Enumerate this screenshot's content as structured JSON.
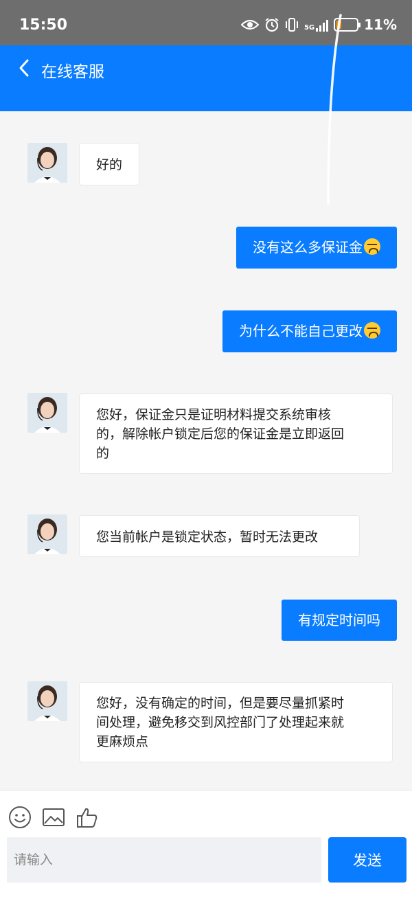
{
  "status_bar": {
    "time": "15:50",
    "network": "5G",
    "battery_percent": "11%",
    "battery_level": 0.11,
    "icons": [
      "eye-icon",
      "alarm-icon",
      "vibrate-icon",
      "signal-icon",
      "battery-icon"
    ]
  },
  "header": {
    "title": "在线客服",
    "back_icon": "chevron-left-icon",
    "color": "#0a7cff"
  },
  "messages": [
    {
      "side": "agent",
      "text": "好的"
    },
    {
      "side": "user",
      "text": "没有这么多保证金",
      "emoji": "tired-face-emoji"
    },
    {
      "side": "user",
      "text": "为什么不能自己更改",
      "emoji": "crying-face-emoji"
    },
    {
      "side": "agent",
      "lines": [
        "您好，保证金只是证明材料提交系统审核",
        "的，解除帐户锁定后您的保证金是立即返回",
        "的"
      ]
    },
    {
      "side": "agent",
      "text": "您当前帐户是锁定状态，暂时无法更改"
    },
    {
      "side": "user",
      "text": "有规定时间吗"
    },
    {
      "side": "agent",
      "lines": [
        "您好，没有确定的时间，但是要尽量抓紧时",
        "间处理，避免移交到风控部门了处理起来就",
        "更麻烦点"
      ]
    }
  ],
  "toolbar": {
    "icons": [
      "smiley-icon",
      "image-icon",
      "thumbs-up-icon"
    ],
    "input_placeholder": "请输入",
    "send_label": "发送"
  }
}
